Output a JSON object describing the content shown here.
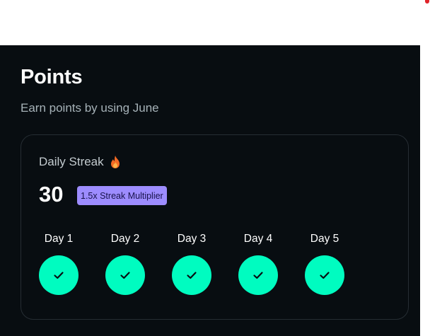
{
  "page": {
    "title": "Points",
    "subtitle": "Earn points by using June"
  },
  "streak": {
    "label": "Daily Streak",
    "icon": "fire-icon",
    "count": "30",
    "multiplier_badge": "1.5x Streak Multiplier"
  },
  "days": [
    {
      "label": "Day 1",
      "completed": true
    },
    {
      "label": "Day 2",
      "completed": true
    },
    {
      "label": "Day 3",
      "completed": true
    },
    {
      "label": "Day 4",
      "completed": true
    },
    {
      "label": "Day 5",
      "completed": true
    }
  ],
  "colors": {
    "background": "#080d11",
    "accent": "#00fcc0",
    "badge": "#9d8cff",
    "notification": "#e0242a"
  }
}
